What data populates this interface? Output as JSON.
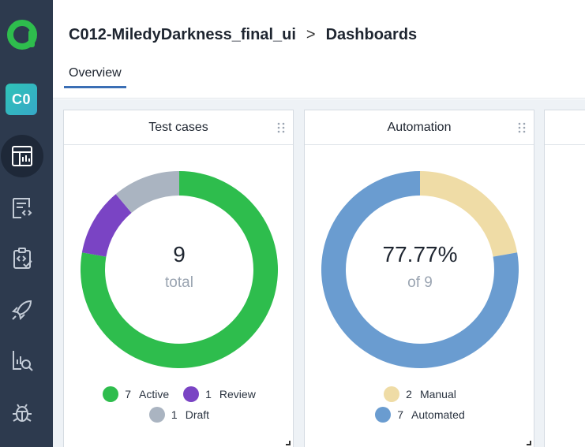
{
  "sidebar": {
    "logo_icon": "app-logo-icon",
    "project_badge": "C0",
    "nav": [
      {
        "icon": "dashboard-icon",
        "active": true
      },
      {
        "icon": "test-cases-icon",
        "active": false
      },
      {
        "icon": "test-plans-icon",
        "active": false
      },
      {
        "icon": "launches-icon",
        "active": false
      },
      {
        "icon": "analytics-icon",
        "active": false
      },
      {
        "icon": "defects-icon",
        "active": false
      }
    ]
  },
  "header": {
    "project": "C012-MiledyDarkness_final_ui",
    "separator": ">",
    "page": "Dashboards",
    "tabs": [
      {
        "label": "Overview",
        "active": true
      }
    ]
  },
  "widgets": [
    {
      "title": "Test cases",
      "center_value": "9",
      "center_label": "total",
      "legend": [
        {
          "count": "7",
          "label": "Active",
          "color": "#2ebd4d"
        },
        {
          "count": "1",
          "label": "Review",
          "color": "#7a44c4"
        },
        {
          "count": "1",
          "label": "Draft",
          "color": "#aab4c1"
        }
      ]
    },
    {
      "title": "Automation",
      "center_value": "77.77%",
      "center_label": "of 9",
      "legend": [
        {
          "count": "2",
          "label": "Manual",
          "color": "#efdca6"
        },
        {
          "count": "7",
          "label": "Automated",
          "color": "#6a9cd0"
        }
      ]
    }
  ],
  "chart_data": [
    {
      "type": "pie",
      "title": "Test cases",
      "categories": [
        "Active",
        "Review",
        "Draft"
      ],
      "values": [
        7,
        1,
        1
      ],
      "colors": [
        "#2ebd4d",
        "#7a44c4",
        "#aab4c1"
      ]
    },
    {
      "type": "pie",
      "title": "Automation",
      "categories": [
        "Manual",
        "Automated"
      ],
      "values": [
        2,
        7
      ],
      "colors": [
        "#efdca6",
        "#6a9cd0"
      ]
    }
  ]
}
